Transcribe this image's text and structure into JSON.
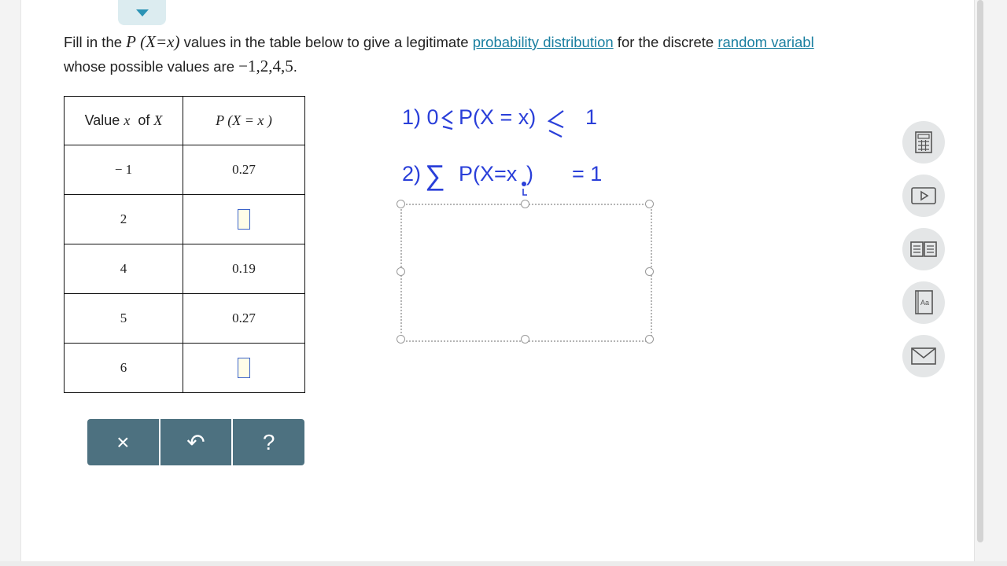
{
  "question": {
    "line1_a": "Fill in the ",
    "P": "P",
    "paren_expr": "(X=x)",
    "line1_b": " values in the table below to give a legitimate ",
    "link1": "probability distribution",
    "line1_c": " for the discrete ",
    "link2": "random variabl",
    "line2_a": "whose possible values are ",
    "values_math": "−1,2,4,5",
    "line2_end": "."
  },
  "table": {
    "header_value": "Value",
    "header_x": "x",
    "header_of": "of",
    "header_X": "X",
    "header_prob": "P (X = x )",
    "rows": [
      {
        "value": "− 1",
        "prob": "0.27"
      },
      {
        "value": "2",
        "prob": ""
      },
      {
        "value": "4",
        "prob": "0.19"
      },
      {
        "value": "5",
        "prob": "0.27"
      },
      {
        "value": "6",
        "prob": ""
      }
    ]
  },
  "toolbar": {
    "clear": "×",
    "undo": "↶",
    "help": "?"
  },
  "annotations": {
    "line1_prefix": "1) 0",
    "line1_mid": "P(X = x)",
    "line1_end": "1",
    "line2_prefix": "2)",
    "line2_sigma": "∑",
    "line2_expr": "P(X=x",
    "line2_close": ")",
    "line2_end": "= 1"
  },
  "sidebar_icons": [
    "calculator-icon",
    "video-icon",
    "book-icon",
    "dictionary-icon",
    "mail-icon"
  ],
  "colors": {
    "accent": "#1a7fa0",
    "toolbar": "#4d7180",
    "ink": "#2a3fd9"
  }
}
